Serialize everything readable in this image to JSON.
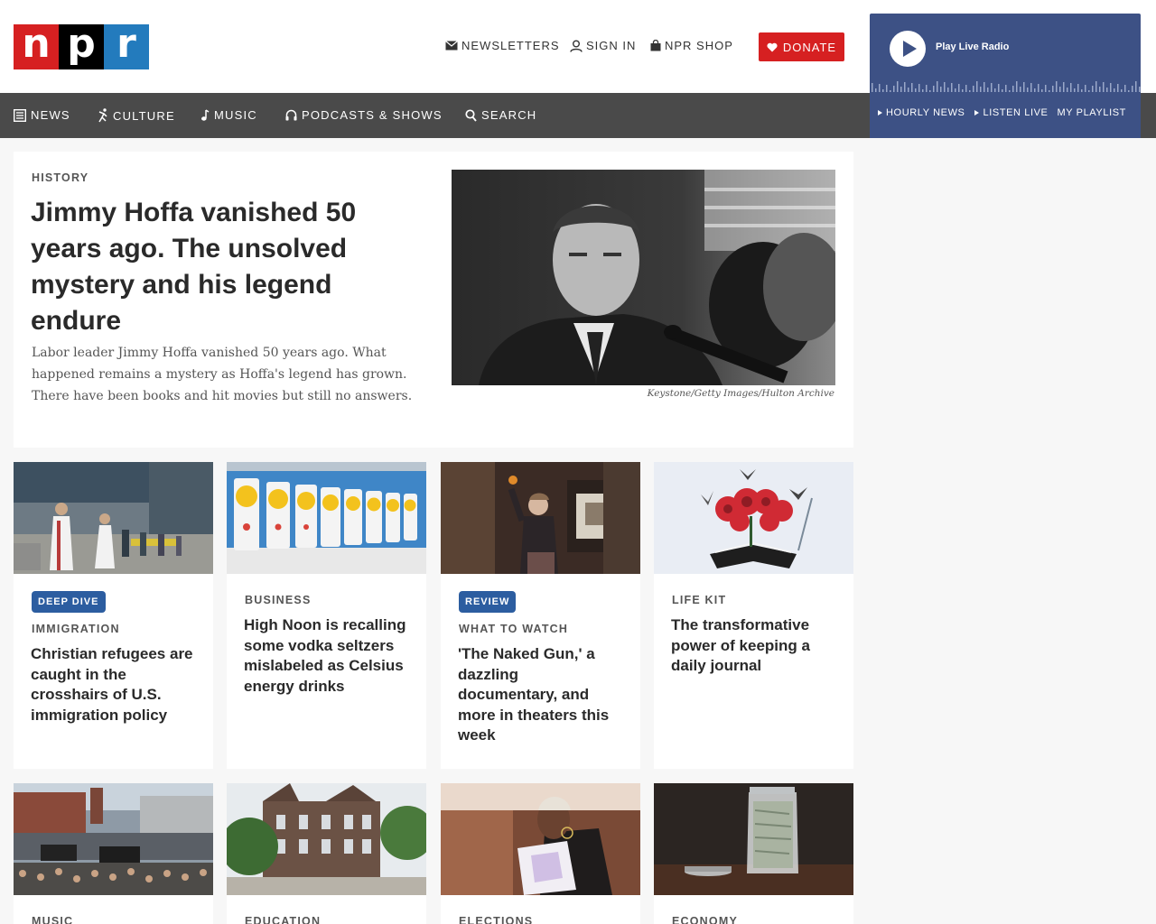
{
  "header": {
    "logo_letters": [
      "n",
      "p",
      "r"
    ],
    "newsletters": "NEWSLETTERS",
    "sign_in": "SIGN IN",
    "shop": "NPR SHOP",
    "donate": "DONATE"
  },
  "player": {
    "label": "Play Live Radio",
    "links": [
      "HOURLY NEWS",
      "LISTEN LIVE",
      "MY PLAYLIST"
    ]
  },
  "nav": {
    "news": "NEWS",
    "culture": "CULTURE",
    "music": "MUSIC",
    "podcasts": "PODCASTS & SHOWS",
    "search": "SEARCH"
  },
  "lead": {
    "kicker": "HISTORY",
    "title": "Jimmy Hoffa vanished 50 years ago. The unsolved mystery and his legend endure",
    "teaser": "Labor leader Jimmy Hoffa vanished 50 years ago. What happened remains a mystery as Hoffa's legend has grown. There have been books and hit movies but still no answers.",
    "credit": "Keystone/Getty Images/Hulton Archive"
  },
  "cards": [
    {
      "badge": "DEEP DIVE",
      "kicker": "IMMIGRATION",
      "title": "Christian refugees are caught in the crosshairs of U.S. immigration policy"
    },
    {
      "badge": "",
      "kicker": "BUSINESS",
      "title": "High Noon is recalling some vodka seltzers mislabeled as Celsius energy drinks"
    },
    {
      "badge": "REVIEW",
      "kicker": "WHAT TO WATCH",
      "title": "'The Naked Gun,' a dazzling documentary, and more in theaters this week"
    },
    {
      "badge": "",
      "kicker": "LIFE KIT",
      "title": "The transformative power of keeping a daily journal"
    }
  ],
  "cards_row2": [
    {
      "kicker": "MUSIC"
    },
    {
      "kicker": "EDUCATION"
    },
    {
      "kicker": "ELECTIONS"
    },
    {
      "kicker": "ECONOMY"
    }
  ],
  "colors": {
    "npr_red": "#d62021",
    "npr_blue": "#237bbd",
    "player_blue": "#3d5185",
    "nav_gray": "#4a4a4a",
    "badge_blue": "#2c5da0"
  }
}
